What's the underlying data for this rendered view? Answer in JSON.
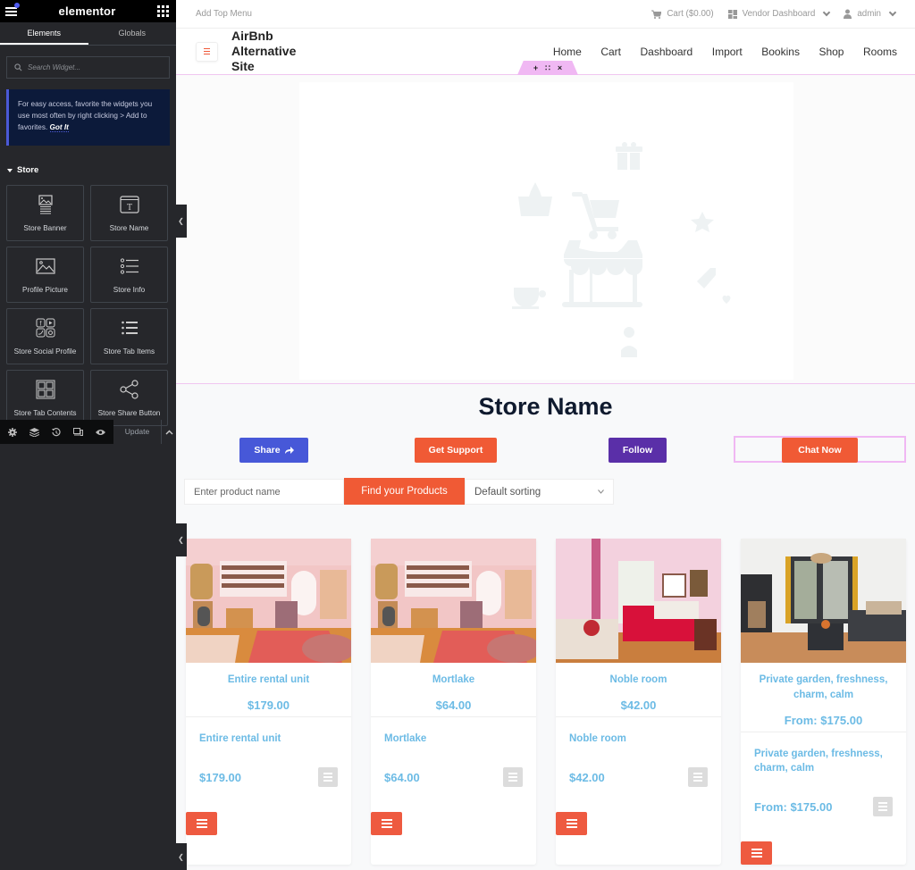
{
  "editor": {
    "logo": "elementor",
    "tabs": [
      {
        "label": "Elements",
        "active": true
      },
      {
        "label": "Globals",
        "active": false
      }
    ],
    "search_placeholder": "Search Widget...",
    "tip": {
      "text": "For easy access, favorite the widgets you use most often by right clicking > Add to favorites.",
      "action": "Got It"
    },
    "category": "Store",
    "widgets": [
      {
        "label": "Store Banner",
        "icon": "banner-icon"
      },
      {
        "label": "Store Name",
        "icon": "text-box-icon"
      },
      {
        "label": "Profile Picture",
        "icon": "image-icon"
      },
      {
        "label": "Store Info",
        "icon": "list-bullets-icon"
      },
      {
        "label": "Store Social Profile",
        "icon": "social-icons-icon"
      },
      {
        "label": "Store Tab Items",
        "icon": "list-icon"
      },
      {
        "label": "Store Tab Contents",
        "icon": "tab-grid-icon"
      },
      {
        "label": "Store Share Button",
        "icon": "share-icon"
      }
    ],
    "footer": {
      "tools": [
        "settings-icon",
        "navigator-layers-icon",
        "history-icon",
        "responsive-mode-icon",
        "preview-eye-icon"
      ],
      "update_label": "Update"
    },
    "accent": "#4b59d6"
  },
  "site": {
    "topbar": {
      "add_menu": "Add Top Menu",
      "cart": "Cart ($0.00)",
      "vendor_dashboard": "Vendor Dashboard",
      "user": "admin"
    },
    "title": "AirBnb Alternative Site",
    "nav": [
      "Home",
      "Cart",
      "Dashboard",
      "Import",
      "Bookins",
      "Shop",
      "Rooms"
    ],
    "section_handle": {
      "add": "+",
      "move": "∷",
      "close": "×"
    },
    "store_name": "Store Name",
    "buttons": {
      "share": {
        "label": "Share",
        "color": "#4758d8"
      },
      "support": {
        "label": "Get Support",
        "color": "#f05a35"
      },
      "follow": {
        "label": "Follow",
        "color": "#5a2fa8"
      },
      "chat": {
        "label": "Chat Now",
        "color": "#f05a35"
      }
    },
    "search": {
      "placeholder": "Enter product name",
      "button": "Find your Products",
      "sort_selected": "Default sorting"
    },
    "products": [
      {
        "title": "Entire rental unit",
        "price": "$179.00",
        "image": "pink-living-room"
      },
      {
        "title": "Mortlake",
        "price": "$64.00",
        "image": "pink-living-room"
      },
      {
        "title": "Noble room",
        "price": "$42.00",
        "image": "pink-bedroom"
      },
      {
        "title": "Private garden, freshness, charm, calm",
        "price": "From: $175.00",
        "image": "modern-living-room"
      }
    ],
    "product_text_color": "#6cbbe5"
  }
}
